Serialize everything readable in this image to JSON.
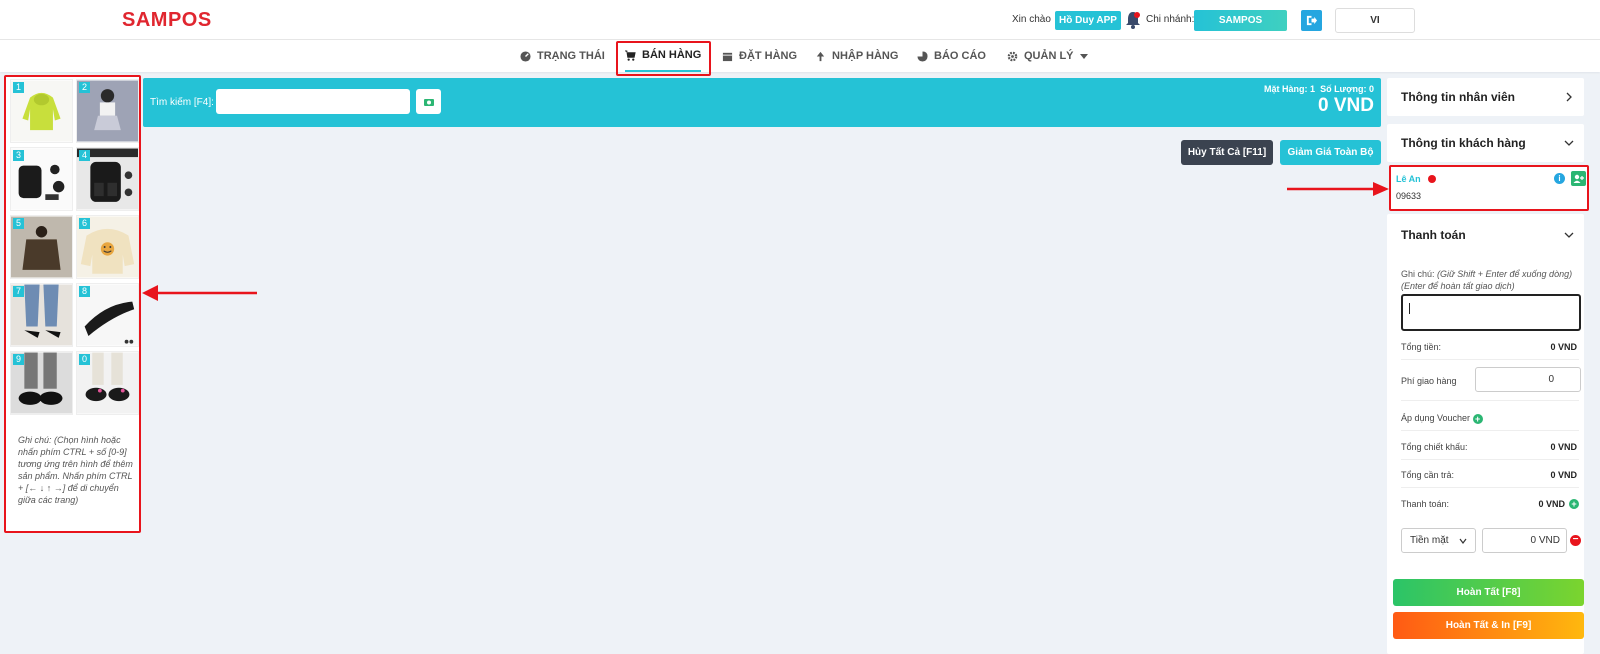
{
  "header": {
    "logo": "SAMPOS",
    "greeting": "Xin chào",
    "user_name": "Hồ Duy APP",
    "branch_label": "Chi nhánh:",
    "branch_name": "SAMPOS",
    "language": "VI"
  },
  "nav": {
    "items": [
      {
        "label": "TRẠNG THÁI",
        "icon": "dashboard-icon"
      },
      {
        "label": "BÁN HÀNG",
        "icon": "cart-icon",
        "active": true
      },
      {
        "label": "ĐẶT HÀNG",
        "icon": "calendar-icon"
      },
      {
        "label": "NHẬP HÀNG",
        "icon": "arrow-up-icon"
      },
      {
        "label": "BÁO CÁO",
        "icon": "pie-chart-icon"
      },
      {
        "label": "QUẢN LÝ",
        "icon": "gear-icon"
      }
    ]
  },
  "products": {
    "items": [
      {
        "key": "1",
        "name": "lime hoodie"
      },
      {
        "key": "2",
        "name": "girl in skirt"
      },
      {
        "key": "3",
        "name": "black backpack set"
      },
      {
        "key": "4",
        "name": "black backpack"
      },
      {
        "key": "5",
        "name": "brown jacket"
      },
      {
        "key": "6",
        "name": "cream smiley hoodie"
      },
      {
        "key": "7",
        "name": "jeans with heels"
      },
      {
        "key": "8",
        "name": "black slide sandal"
      },
      {
        "key": "9",
        "name": "black loafers"
      },
      {
        "key": "0",
        "name": "black sneakers"
      }
    ],
    "note": "Ghi chú: (Chọn hình hoặc nhấn phím CTRL + số [0-9] tương ứng trên hình để thêm sản phẩm. Nhấn phím CTRL + [← ↓ ↑ →] để di chuyển giữa các trang)"
  },
  "search": {
    "label": "Tìm kiếm [F4]:",
    "placeholder": "",
    "items_label": "Mặt Hàng:",
    "items_count": "1",
    "qty_label": "Số Lượng:",
    "qty_count": "0",
    "total": "0 VND"
  },
  "actions": {
    "cancel_all": "Hủy Tất Cả [F11]",
    "discount_all": "Giảm Giá Toàn Bộ"
  },
  "right_panel": {
    "employee_info": "Thông tin nhân viên",
    "customer_info": "Thông tin khách hàng",
    "customer": {
      "name": "Lê An",
      "phone": "09633"
    },
    "payment": {
      "title": "Thanh toán",
      "note_label": "Ghi chú:",
      "note_hint1": "(Giữ Shift + Enter để xuống dòng)",
      "note_hint2": "(Enter để hoàn tất giao dịch)",
      "total_label": "Tổng tiền:",
      "total_value": "0 VND",
      "shipping_label": "Phí giao hàng",
      "shipping_value": "0",
      "voucher_label": "Áp dụng Voucher",
      "discount_label": "Tổng chiết khấu:",
      "discount_value": "0 VND",
      "payable_label": "Tổng cần trả:",
      "payable_value": "0 VND",
      "paid_label": "Thanh toán:",
      "paid_value": "0 VND",
      "method": "Tiền mặt",
      "method_amount": "0  VND",
      "complete": "Hoàn Tất [F8]",
      "complete_print": "Hoàn Tất & In [F9]"
    }
  },
  "colors": {
    "brand": "#e0262f",
    "accent": "#25c2d6",
    "highlight": "#e8141c",
    "success": "#2bb673"
  }
}
